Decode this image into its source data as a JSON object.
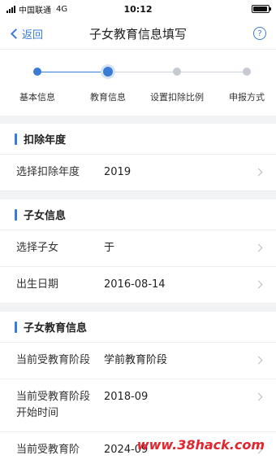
{
  "status_bar": {
    "carrier": "中国联通",
    "network": "4G",
    "time": "10:12",
    "battery_level": 0.95
  },
  "nav": {
    "back_label": "返回",
    "title": "子女教育信息填写",
    "help_icon": "question-circle-icon"
  },
  "stepper": {
    "steps": [
      {
        "label": "基本信息",
        "state": "done"
      },
      {
        "label": "教育信息",
        "state": "current"
      },
      {
        "label": "设置扣除比例",
        "state": "todo"
      },
      {
        "label": "申报方式",
        "state": "todo"
      }
    ]
  },
  "sections": {
    "deduction_year": {
      "title": "扣除年度",
      "rows": [
        {
          "label": "选择扣除年度",
          "value": "2019"
        }
      ]
    },
    "child_info": {
      "title": "子女信息",
      "rows": [
        {
          "label": "选择子女",
          "value": "于"
        },
        {
          "label": "出生日期",
          "value": "2016-08-14"
        }
      ]
    },
    "child_education": {
      "title": "子女教育信息",
      "rows": [
        {
          "label": "当前受教育阶段",
          "value": "学前教育阶段"
        },
        {
          "label": "当前受教育阶段开始时间",
          "value": "2018-09"
        },
        {
          "label": "当前受教育阶",
          "value": "2024-09"
        }
      ]
    }
  },
  "watermark": "www.38hack.com",
  "colors": {
    "accent": "#3a7bd5",
    "watermark": "#e0262f"
  }
}
